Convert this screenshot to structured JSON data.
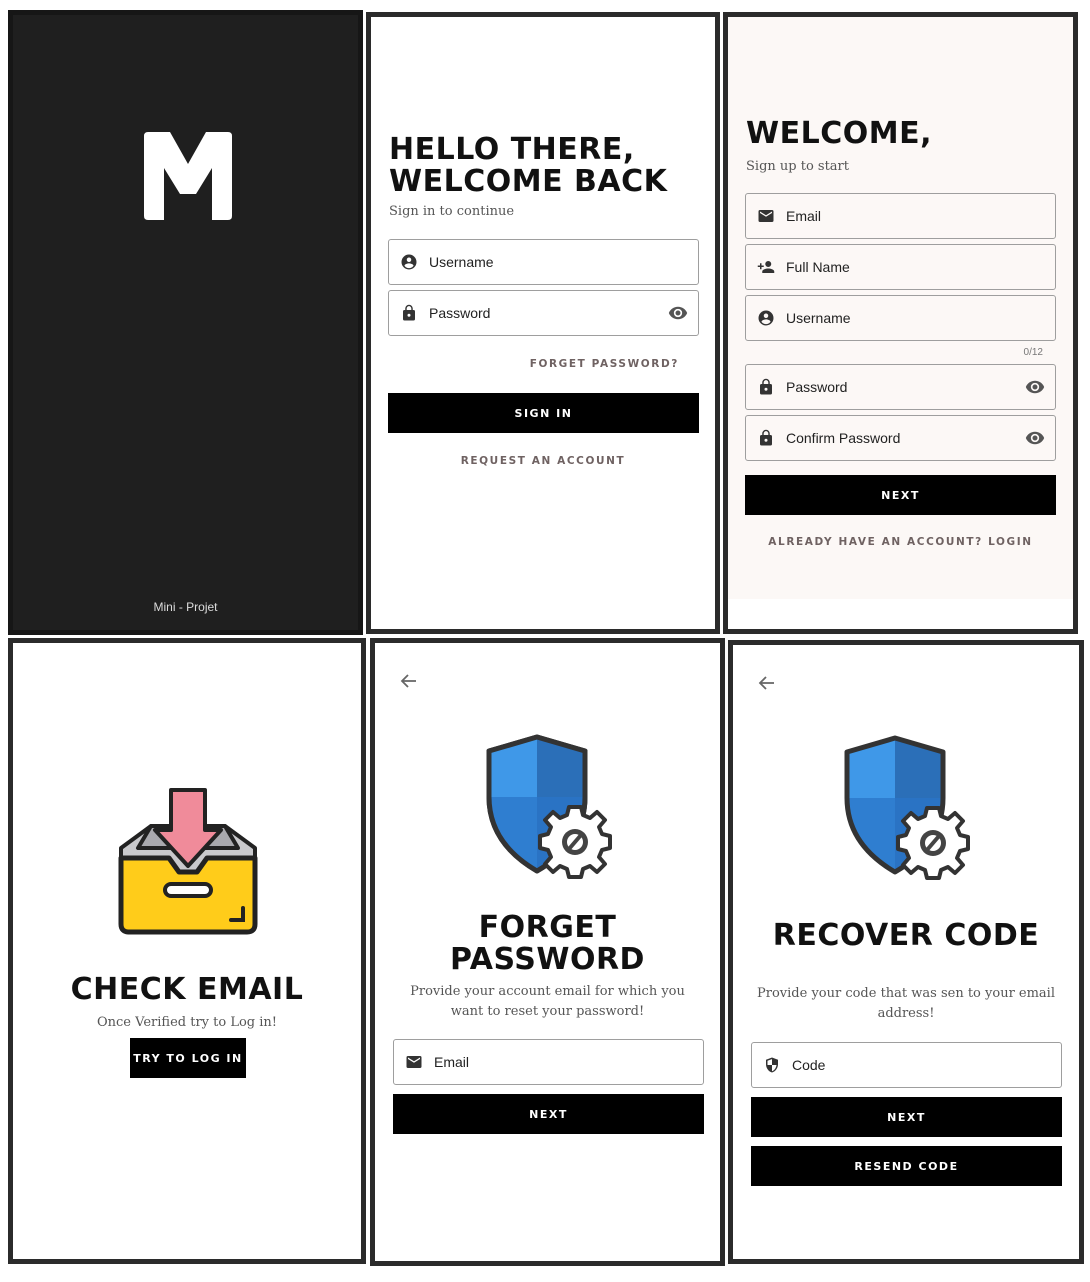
{
  "splash": {
    "logo_letter": "M",
    "footer": "Mini - Projet"
  },
  "login": {
    "title_line1": "HELLO THERE,",
    "title_line2": "WELCOME BACK",
    "subtitle": "Sign in to continue",
    "username_label": "Username",
    "password_label": "Password",
    "forget_link": "FORGET PASSWORD?",
    "signin_button": "SIGN IN",
    "request_link": "REQUEST AN ACCOUNT"
  },
  "signup": {
    "title": "WELCOME,",
    "subtitle": "Sign up to start",
    "email_label": "Email",
    "fullname_label": "Full Name",
    "username_label": "Username",
    "username_counter": "0/12",
    "password_label": "Password",
    "confirm_label": "Confirm Password",
    "next_button": "NEXT",
    "login_link": "ALREADY HAVE AN ACCOUNT? LOGIN"
  },
  "check_email": {
    "title": "CHECK EMAIL",
    "message": "Once Verified try to Log in!",
    "button": "TRY TO LOG IN"
  },
  "forget_password": {
    "title_line1": "FORGET",
    "title_line2": "PASSWORD",
    "description": "Provide your account email for which you want to reset your password!",
    "email_label": "Email",
    "next_button": "NEXT"
  },
  "recover_code": {
    "title": "RECOVER CODE",
    "description": "Provide your code that was sen to your email address!",
    "code_label": "Code",
    "next_button": "NEXT",
    "resend_button": "RESEND CODE"
  },
  "colors": {
    "splash_bg": "#1f1f1f",
    "button_bg": "#000000",
    "link_color": "#6f6262",
    "shield_blue": "#2e7fd6",
    "inbox_yellow": "#ffcc1a",
    "arrow_pink": "#f08b9a"
  }
}
